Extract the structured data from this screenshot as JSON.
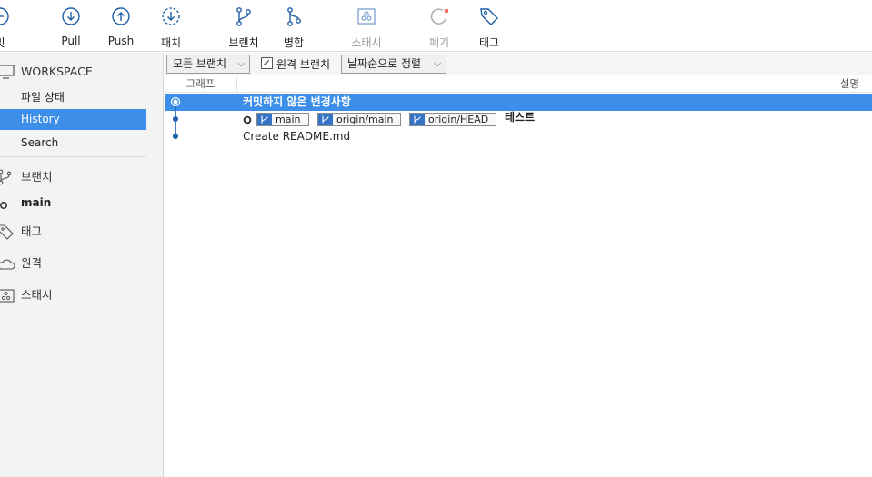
{
  "toolbar": {
    "commit_label": "밋",
    "pull_label": "Pull",
    "push_label": "Push",
    "fetch_label": "패치",
    "branch_label": "브랜치",
    "merge_label": "병합",
    "stash_label": "스태시",
    "discard_label": "폐기",
    "tag_label": "태그"
  },
  "sidebar": {
    "workspace": "WORKSPACE",
    "file_status": "파일 상태",
    "history": "History",
    "search": "Search",
    "branches": "브랜치",
    "branch_main": "main",
    "tags": "태그",
    "remotes": "원격",
    "stashes": "스태시"
  },
  "filter": {
    "branch_combo": "모든 브랜치",
    "remote_branches_label": "원격 브랜치",
    "remote_branches_checked": true,
    "sort_combo": "날짜순으로 정렬"
  },
  "table": {
    "col_graph": "그래프",
    "col_desc": "설명"
  },
  "commits": [
    {
      "message": "커밋하지 않은 변경사항",
      "selected": true
    },
    {
      "refs": [
        "main",
        "origin/main",
        "origin/HEAD"
      ],
      "message": "테스트"
    },
    {
      "message": "Create README.md"
    }
  ],
  "colors": {
    "accent": "#3d8ee8",
    "icon_blue": "#1e5fa8",
    "ref_icon": "#3473c5"
  }
}
